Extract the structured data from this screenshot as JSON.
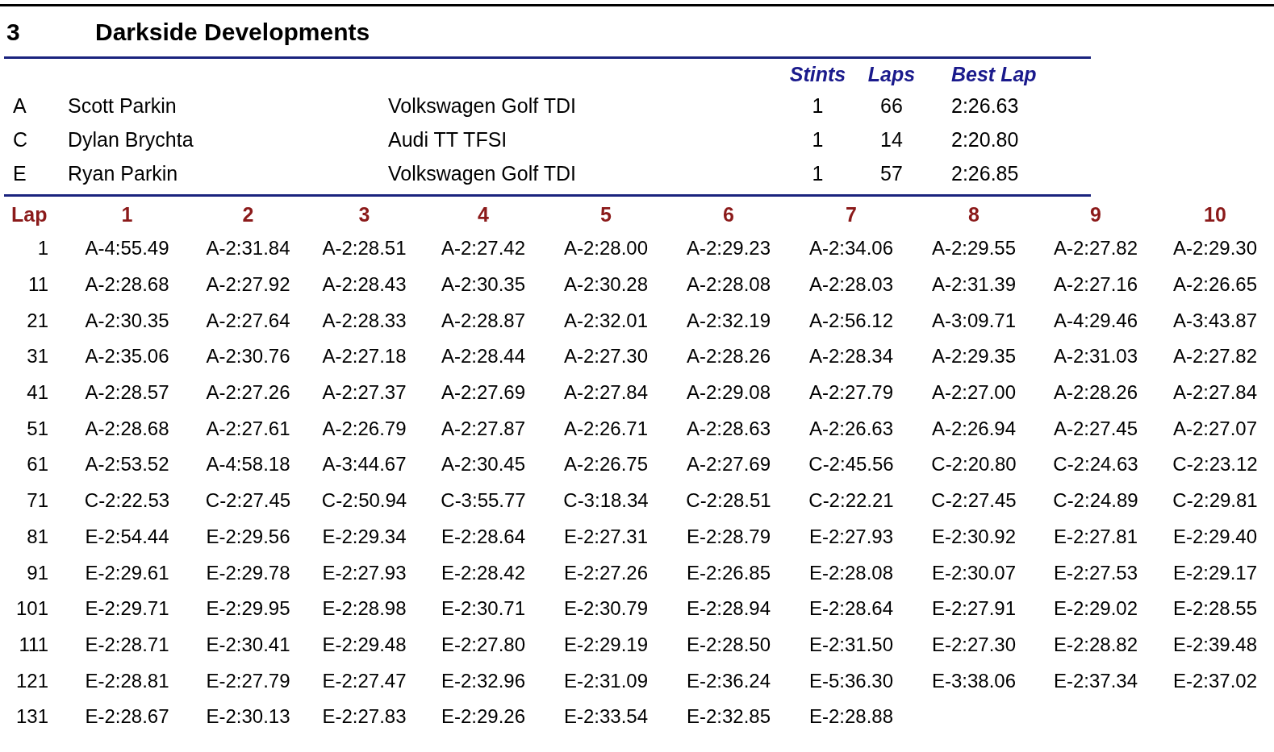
{
  "team": {
    "number": "3",
    "name": "Darkside Developments"
  },
  "drivers": {
    "columns": [
      "Stints",
      "Laps",
      "Best Lap"
    ],
    "rows": [
      {
        "code": "A",
        "name": "Scott Parkin",
        "car": "Volkswagen Golf TDI",
        "stints": "1",
        "laps": "66",
        "best_lap": "2:26.63"
      },
      {
        "code": "C",
        "name": "Dylan Brychta",
        "car": "Audi TT TFSI",
        "stints": "1",
        "laps": "14",
        "best_lap": "2:20.80"
      },
      {
        "code": "E",
        "name": "Ryan Parkin",
        "car": "Volkswagen Golf TDI",
        "stints": "1",
        "laps": "57",
        "best_lap": "2:26.85"
      }
    ]
  },
  "laps": {
    "header": "Lap",
    "columns": [
      "1",
      "2",
      "3",
      "4",
      "5",
      "6",
      "7",
      "8",
      "9",
      "10"
    ],
    "rows": [
      {
        "lap": "1",
        "times": [
          "A-4:55.49",
          "A-2:31.84",
          "A-2:28.51",
          "A-2:27.42",
          "A-2:28.00",
          "A-2:29.23",
          "A-2:34.06",
          "A-2:29.55",
          "A-2:27.82",
          "A-2:29.30"
        ]
      },
      {
        "lap": "11",
        "times": [
          "A-2:28.68",
          "A-2:27.92",
          "A-2:28.43",
          "A-2:30.35",
          "A-2:30.28",
          "A-2:28.08",
          "A-2:28.03",
          "A-2:31.39",
          "A-2:27.16",
          "A-2:26.65"
        ]
      },
      {
        "lap": "21",
        "times": [
          "A-2:30.35",
          "A-2:27.64",
          "A-2:28.33",
          "A-2:28.87",
          "A-2:32.01",
          "A-2:32.19",
          "A-2:56.12",
          "A-3:09.71",
          "A-4:29.46",
          "A-3:43.87"
        ]
      },
      {
        "lap": "31",
        "times": [
          "A-2:35.06",
          "A-2:30.76",
          "A-2:27.18",
          "A-2:28.44",
          "A-2:27.30",
          "A-2:28.26",
          "A-2:28.34",
          "A-2:29.35",
          "A-2:31.03",
          "A-2:27.82"
        ]
      },
      {
        "lap": "41",
        "times": [
          "A-2:28.57",
          "A-2:27.26",
          "A-2:27.37",
          "A-2:27.69",
          "A-2:27.84",
          "A-2:29.08",
          "A-2:27.79",
          "A-2:27.00",
          "A-2:28.26",
          "A-2:27.84"
        ]
      },
      {
        "lap": "51",
        "times": [
          "A-2:28.68",
          "A-2:27.61",
          "A-2:26.79",
          "A-2:27.87",
          "A-2:26.71",
          "A-2:28.63",
          "A-2:26.63",
          "A-2:26.94",
          "A-2:27.45",
          "A-2:27.07"
        ]
      },
      {
        "lap": "61",
        "times": [
          "A-2:53.52",
          "A-4:58.18",
          "A-3:44.67",
          "A-2:30.45",
          "A-2:26.75",
          "A-2:27.69",
          "C-2:45.56",
          "C-2:20.80",
          "C-2:24.63",
          "C-2:23.12"
        ]
      },
      {
        "lap": "71",
        "times": [
          "C-2:22.53",
          "C-2:27.45",
          "C-2:50.94",
          "C-3:55.77",
          "C-3:18.34",
          "C-2:28.51",
          "C-2:22.21",
          "C-2:27.45",
          "C-2:24.89",
          "C-2:29.81"
        ]
      },
      {
        "lap": "81",
        "times": [
          "E-2:54.44",
          "E-2:29.56",
          "E-2:29.34",
          "E-2:28.64",
          "E-2:27.31",
          "E-2:28.79",
          "E-2:27.93",
          "E-2:30.92",
          "E-2:27.81",
          "E-2:29.40"
        ]
      },
      {
        "lap": "91",
        "times": [
          "E-2:29.61",
          "E-2:29.78",
          "E-2:27.93",
          "E-2:28.42",
          "E-2:27.26",
          "E-2:26.85",
          "E-2:28.08",
          "E-2:30.07",
          "E-2:27.53",
          "E-2:29.17"
        ]
      },
      {
        "lap": "101",
        "times": [
          "E-2:29.71",
          "E-2:29.95",
          "E-2:28.98",
          "E-2:30.71",
          "E-2:30.79",
          "E-2:28.94",
          "E-2:28.64",
          "E-2:27.91",
          "E-2:29.02",
          "E-2:28.55"
        ]
      },
      {
        "lap": "111",
        "times": [
          "E-2:28.71",
          "E-2:30.41",
          "E-2:29.48",
          "E-2:27.80",
          "E-2:29.19",
          "E-2:28.50",
          "E-2:31.50",
          "E-2:27.30",
          "E-2:28.82",
          "E-2:39.48"
        ]
      },
      {
        "lap": "121",
        "times": [
          "E-2:28.81",
          "E-2:27.79",
          "E-2:27.47",
          "E-2:32.96",
          "E-2:31.09",
          "E-2:36.24",
          "E-5:36.30",
          "E-3:38.06",
          "E-2:37.34",
          "E-2:37.02"
        ]
      },
      {
        "lap": "131",
        "times": [
          "E-2:28.67",
          "E-2:30.13",
          "E-2:27.83",
          "E-2:29.26",
          "E-2:33.54",
          "E-2:32.85",
          "E-2:28.88"
        ]
      }
    ]
  }
}
